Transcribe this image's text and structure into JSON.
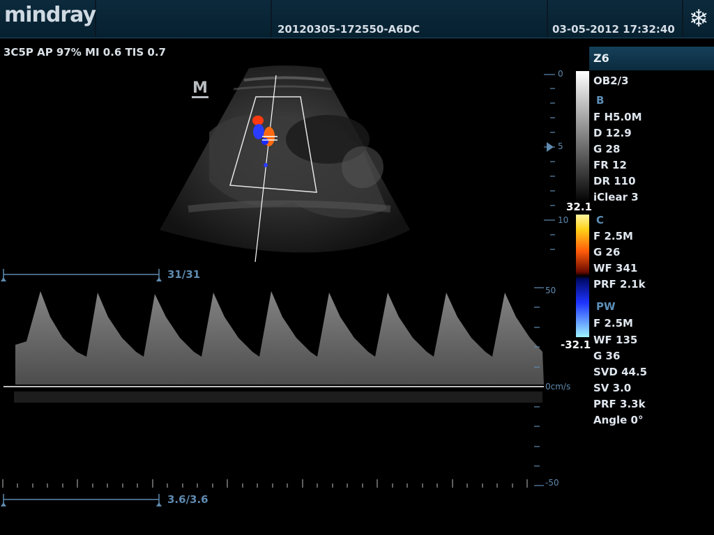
{
  "header": {
    "logo": "mindray",
    "exam_id": "20120305-172550-A6DC",
    "datetime": "03-05-2012  17:32:40",
    "freeze_icon": "snowflake-icon"
  },
  "imaging_params": "3C5P  AP 97%  MI 0.6  TIS 0.7",
  "m_marker": "M",
  "sidebar": {
    "probe": "Z6",
    "preset": "OB2/3",
    "b_header": "B",
    "b_items": [
      "F H5.0M",
      "D 12.9",
      "G 28",
      "FR 12",
      "DR 110",
      "iClear 3"
    ],
    "c_header": "C",
    "c_items": [
      "F 2.5M",
      "G 26",
      "WF 341",
      "PRF 2.1k"
    ],
    "pw_header": "PW",
    "pw_items": [
      "F 2.5M",
      "WF 135",
      "G 36",
      "SVD 44.5",
      "SV 3.0",
      "PRF 3.3k",
      "Angle 0°"
    ]
  },
  "depth_scale": {
    "labels": [
      "0",
      "5",
      "10"
    ]
  },
  "color_scale": {
    "top": "32.1",
    "bottom": "-32.1"
  },
  "doppler_scale": {
    "top": "50",
    "zero": "0cm/s",
    "bottom": "-50"
  },
  "counters": {
    "b_frames": "31/31",
    "doppler_time": "3.6/3.6"
  },
  "colors": {
    "header_bg": "#0c2a3c",
    "accent": "#5f8bb0"
  }
}
